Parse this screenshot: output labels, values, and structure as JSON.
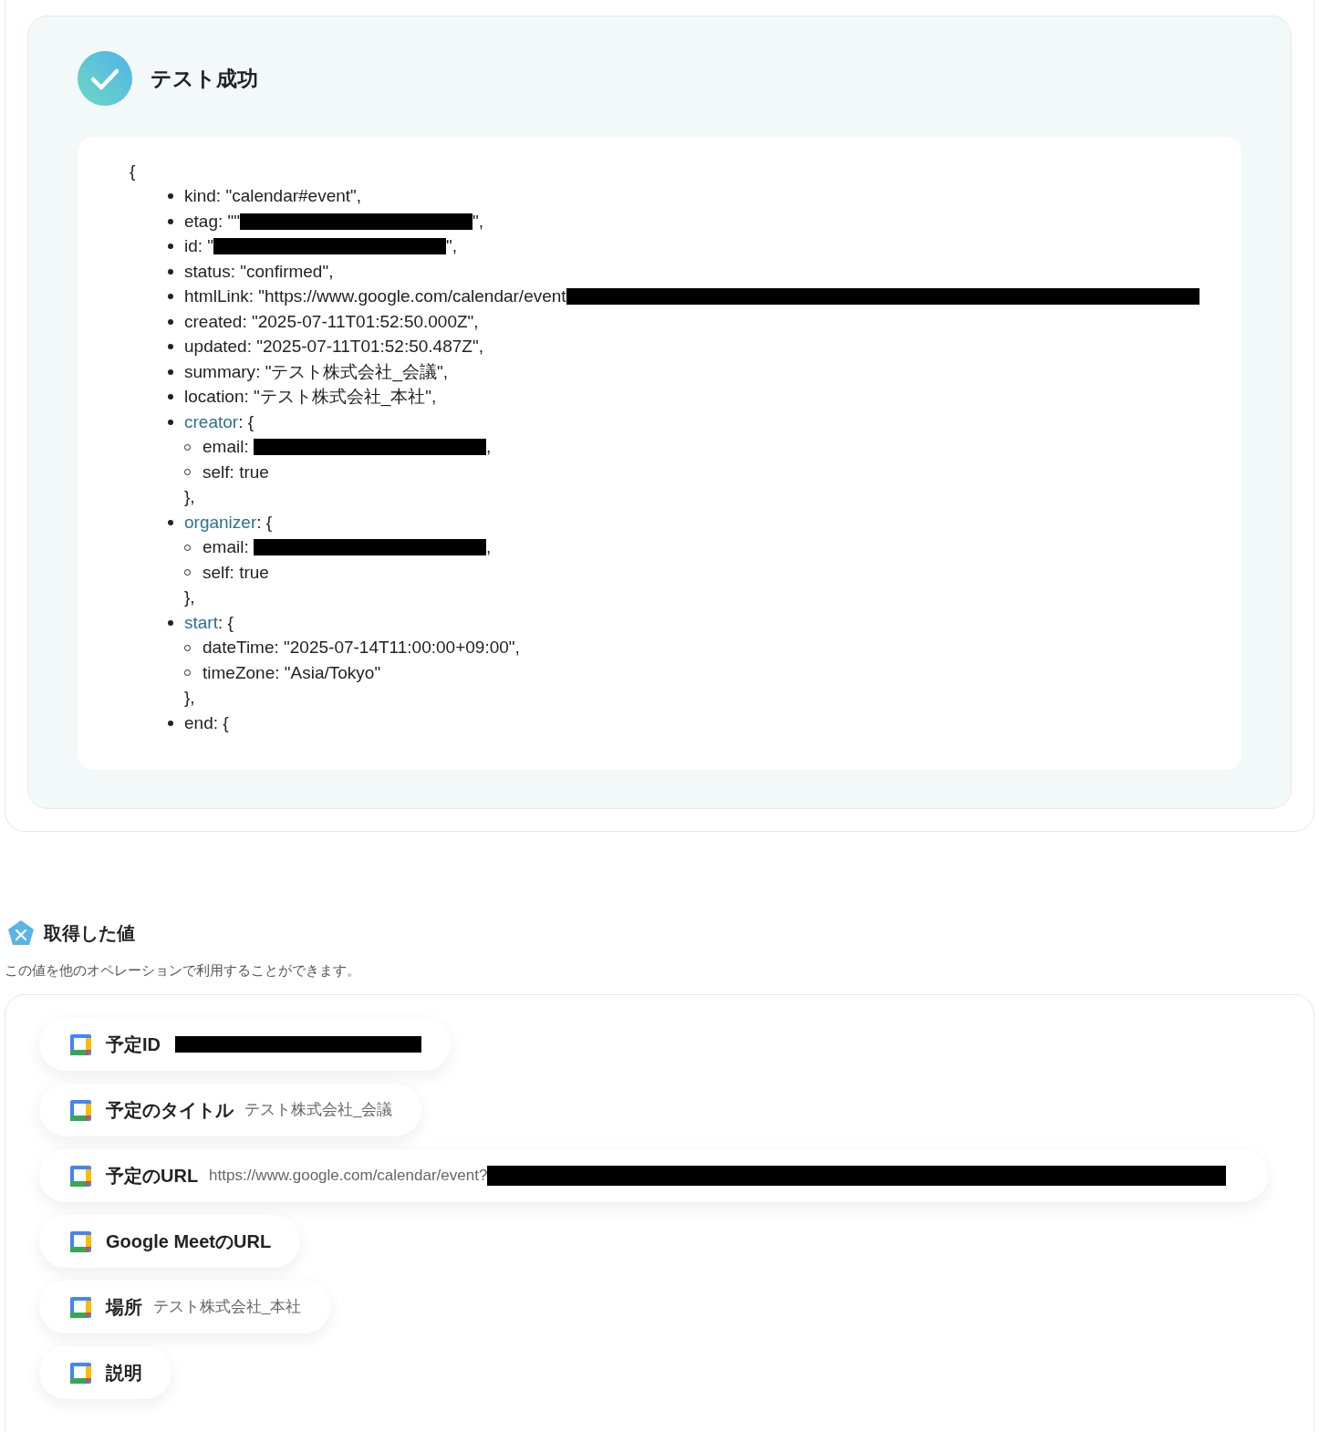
{
  "test_result": {
    "title": "テスト成功",
    "open_brace": "{",
    "entries": [
      {
        "key": "kind",
        "text": ": \"calendar#event\","
      },
      {
        "key": "etag",
        "text": ": \"\"",
        "redacted": true,
        "after": "\","
      },
      {
        "key": "id",
        "text": ": \"",
        "redacted": true,
        "after": "\","
      },
      {
        "key": "status",
        "text": ": \"confirmed\","
      },
      {
        "key": "htmlLink",
        "text": ": \"https://www.google.com/calendar/event",
        "redacted": true
      },
      {
        "key": "created",
        "text": ": \"2025-07-11T01:52:50.000Z\","
      },
      {
        "key": "updated",
        "text": ": \"2025-07-11T01:52:50.487Z\","
      },
      {
        "key": "summary",
        "text": ": \"テスト株式会社_会議\","
      },
      {
        "key": "location",
        "text": ": \"テスト株式会社_本社\","
      },
      {
        "key": "creator",
        "text": ": {",
        "close": "},",
        "children": [
          {
            "key": "email",
            "text": ": ",
            "redacted": true,
            "after": ","
          },
          {
            "key": "self",
            "text": ": true"
          }
        ]
      },
      {
        "key": "organizer",
        "text": ": {",
        "close": "},",
        "children": [
          {
            "key": "email",
            "text": ": ",
            "redacted": true,
            "after": ","
          },
          {
            "key": "self",
            "text": ": true"
          }
        ]
      },
      {
        "key": "start",
        "text": ": {",
        "close": "},",
        "children": [
          {
            "key": "dateTime",
            "text": ": \"2025-07-14T11:00:00+09:00\","
          },
          {
            "key": "timeZone",
            "text": ": \"Asia/Tokyo\""
          }
        ]
      },
      {
        "key": "end",
        "text": ": {"
      }
    ]
  },
  "outputs": {
    "title": "取得した値",
    "subtitle": "この値を他のオペレーションで利用することができます。",
    "items": [
      {
        "label": "予定ID",
        "redacted": true
      },
      {
        "label": "予定のタイトル",
        "value": "テスト株式会社_会議"
      },
      {
        "label": "予定のURL",
        "value": "https://www.google.com/calendar/event?",
        "redacted": true
      },
      {
        "label": "Google MeetのURL"
      },
      {
        "label": "場所",
        "value": "テスト株式会社_本社"
      },
      {
        "label": "説明"
      }
    ]
  }
}
